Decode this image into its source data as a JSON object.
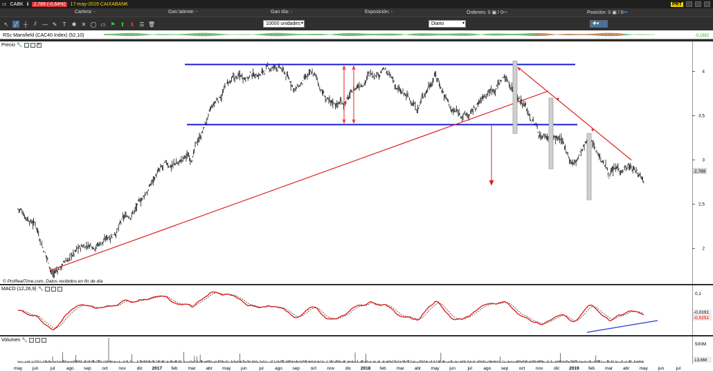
{
  "titlebar": {
    "symbol": "CABK",
    "price_change": "2,789 (-0,64%)",
    "date_name": "17-may-2019 CAIXABANK",
    "prt": "PRT"
  },
  "infobar": {
    "cartera": "Cartera: -",
    "gan_latente": "Gan latente: -",
    "gan_dia": "Gan día: -",
    "exposicion": "Exposición: -",
    "ordenes": "Órdenes: 0",
    "ordenes_count": "0",
    "posicion": "Posición: 0",
    "posicion_count": "0"
  },
  "toolbar": {
    "units": "10000 unidades",
    "period": "Diario"
  },
  "rsc": {
    "label": "RSc Mansfield (CAC40 Index) (52,10)",
    "value": "-0,1922"
  },
  "price_panel": {
    "label": "Precio",
    "current": "2,789",
    "credit": "© ProRealTime.com, Datos recibidos en fin de día",
    "ticks": [
      {
        "label": "4",
        "v": 4.0
      },
      {
        "label": "3,5",
        "v": 3.5
      },
      {
        "label": "3",
        "v": 3.0
      },
      {
        "label": "2,5",
        "v": 2.5
      },
      {
        "label": "2",
        "v": 2.0
      }
    ]
  },
  "macd": {
    "label": "MACD (12,26,9)",
    "tick_top": "0,1",
    "value1": "-0,0191",
    "value2": "-0,0251"
  },
  "volume": {
    "label": "Volumen",
    "tick_top": "500M",
    "value": "13,6M"
  },
  "time_axis": [
    "may",
    "jun",
    "jul",
    "ago",
    "sep",
    "oct",
    "nov",
    "dic",
    "2017",
    "feb",
    "mar",
    "abr",
    "may",
    "jun",
    "jul",
    "ago",
    "sep",
    "oct",
    "nov",
    "dic",
    "2018",
    "feb",
    "mar",
    "abr",
    "may",
    "jun",
    "jul",
    "ago",
    "sep",
    "oct",
    "nov",
    "dic",
    "2019",
    "feb",
    "mar",
    "abr",
    "may",
    "jun",
    "jul"
  ],
  "chart_data": {
    "type": "line",
    "title": "",
    "series": [
      {
        "name": "",
        "points": [
          [
            "may",
            2.45
          ],
          [
            "jun",
            2.3
          ],
          [
            "jul",
            1.72
          ],
          [
            "ago",
            1.9
          ],
          [
            "sep",
            2.05
          ],
          [
            "oct",
            2.1
          ],
          [
            "nov",
            2.3
          ],
          [
            "dic",
            2.5
          ],
          [
            "2017",
            2.85
          ],
          [
            "feb",
            2.95
          ],
          [
            "mar",
            3.05
          ],
          [
            "abr",
            3.5
          ],
          [
            "may",
            3.85
          ],
          [
            "jun",
            3.95
          ],
          [
            "jul",
            4.0
          ],
          [
            "ago",
            4.05
          ],
          [
            "sep",
            3.8
          ],
          [
            "oct",
            3.95
          ],
          [
            "nov",
            3.6
          ],
          [
            "dic",
            3.7
          ],
          [
            "2018",
            3.95
          ],
          [
            "feb",
            4.05
          ],
          [
            "mar",
            3.75
          ],
          [
            "abr",
            3.6
          ],
          [
            "may",
            4.0
          ],
          [
            "jun",
            3.55
          ],
          [
            "jul",
            3.5
          ],
          [
            "ago",
            3.75
          ],
          [
            "sep",
            3.95
          ],
          [
            "oct",
            3.7
          ],
          [
            "nov",
            3.3
          ],
          [
            "dic",
            3.25
          ],
          [
            "2019",
            2.95
          ],
          [
            "feb",
            3.25
          ],
          [
            "mar",
            2.85
          ],
          [
            "abr",
            2.95
          ],
          [
            "may",
            2.79
          ]
        ]
      }
    ],
    "ylim": [
      1.7,
      4.2
    ],
    "grid": false
  }
}
